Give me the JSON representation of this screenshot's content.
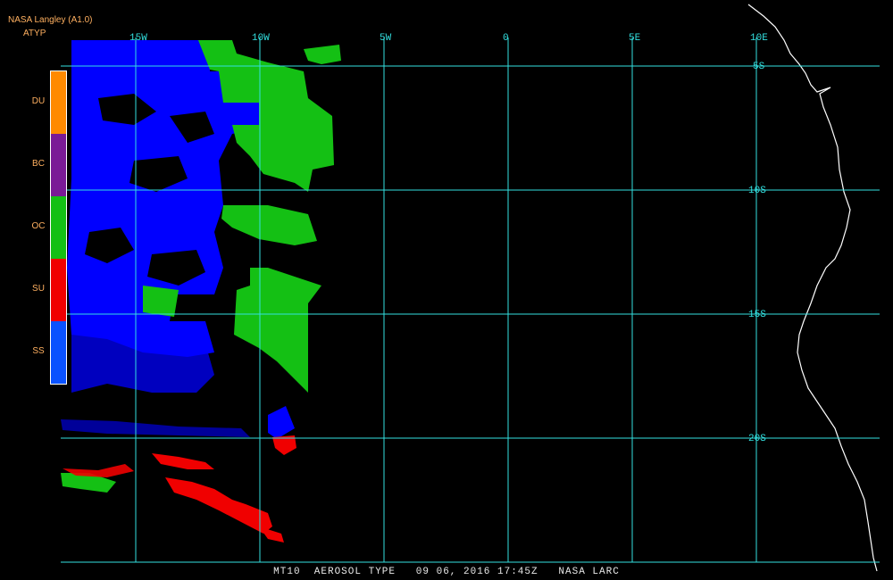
{
  "header": {
    "title": "NASA Langley (A1.0)",
    "product": "ATYP"
  },
  "legend": [
    {
      "code": "DU",
      "color": "#ff8a00"
    },
    {
      "code": "BC",
      "color": "#7a1a96"
    },
    {
      "code": "OC",
      "color": "#14c014"
    },
    {
      "code": "SU",
      "color": "#f00000"
    },
    {
      "code": "SS",
      "color": "#0a52ff"
    }
  ],
  "grid": {
    "lon_labels": [
      "15W",
      "10W",
      "5W",
      "0",
      "5E",
      "10E"
    ],
    "lat_labels": [
      "5S",
      "10S",
      "15S",
      "20S"
    ],
    "line_color": "#33e0e0"
  },
  "footer": {
    "text": "MT10  AEROSOL TYPE   09 06, 2016 17:45Z   NASA LARC"
  },
  "colors": {
    "background": "#000000",
    "coastline": "#ffffff",
    "blue_aerosol": "#0000ff",
    "green_aerosol": "#14c014",
    "red_aerosol": "#f00000"
  }
}
